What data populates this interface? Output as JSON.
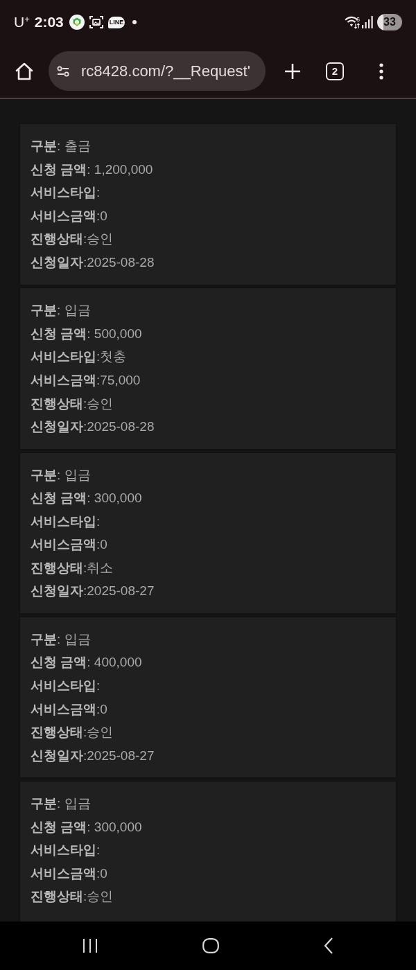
{
  "status_bar": {
    "carrier": "U$^{+}$",
    "time": "2:03",
    "chat_app_badge": "LINE",
    "wifi_badge": "6",
    "battery": "33"
  },
  "browser_toolbar": {
    "url": "rc8428.com/?__Request'",
    "tab_count": "2"
  },
  "records": [
    {
      "lines": [
        "**구분**: 출금",
        "**신청 금액**: 1,200,000",
        "**서비스타입**:",
        "**서비스금액**:0",
        "**진행상태**:승인",
        "**신청일자**:2025-08-28"
      ]
    },
    {
      "lines": [
        "**구분**: 입금",
        "**신청 금액**: 500,000",
        "**서비스타입**:첫충",
        "**서비스금액**:75,000",
        "**진행상태**:승인",
        "**신청일자**:2025-08-28"
      ]
    },
    {
      "lines": [
        "**구분**: 입금",
        "**신청 금액**: 300,000",
        "**서비스타입**:",
        "**서비스금액**:0",
        "**진행상태**:취소",
        "**신청일자**:2025-08-27"
      ]
    },
    {
      "lines": [
        "**구분**: 입금",
        "**신청 금액**: 400,000",
        "**서비스타입**:",
        "**서비스금액**:0",
        "**진행상태**:승인",
        "**신청일자**:2025-08-27"
      ]
    },
    {
      "lines": [
        "**구분**: 입금",
        "**신청 금액**: 300,000",
        "**서비스타입**:",
        "**서비스금액**:0",
        "**진행상태**:승인"
      ]
    }
  ]
}
